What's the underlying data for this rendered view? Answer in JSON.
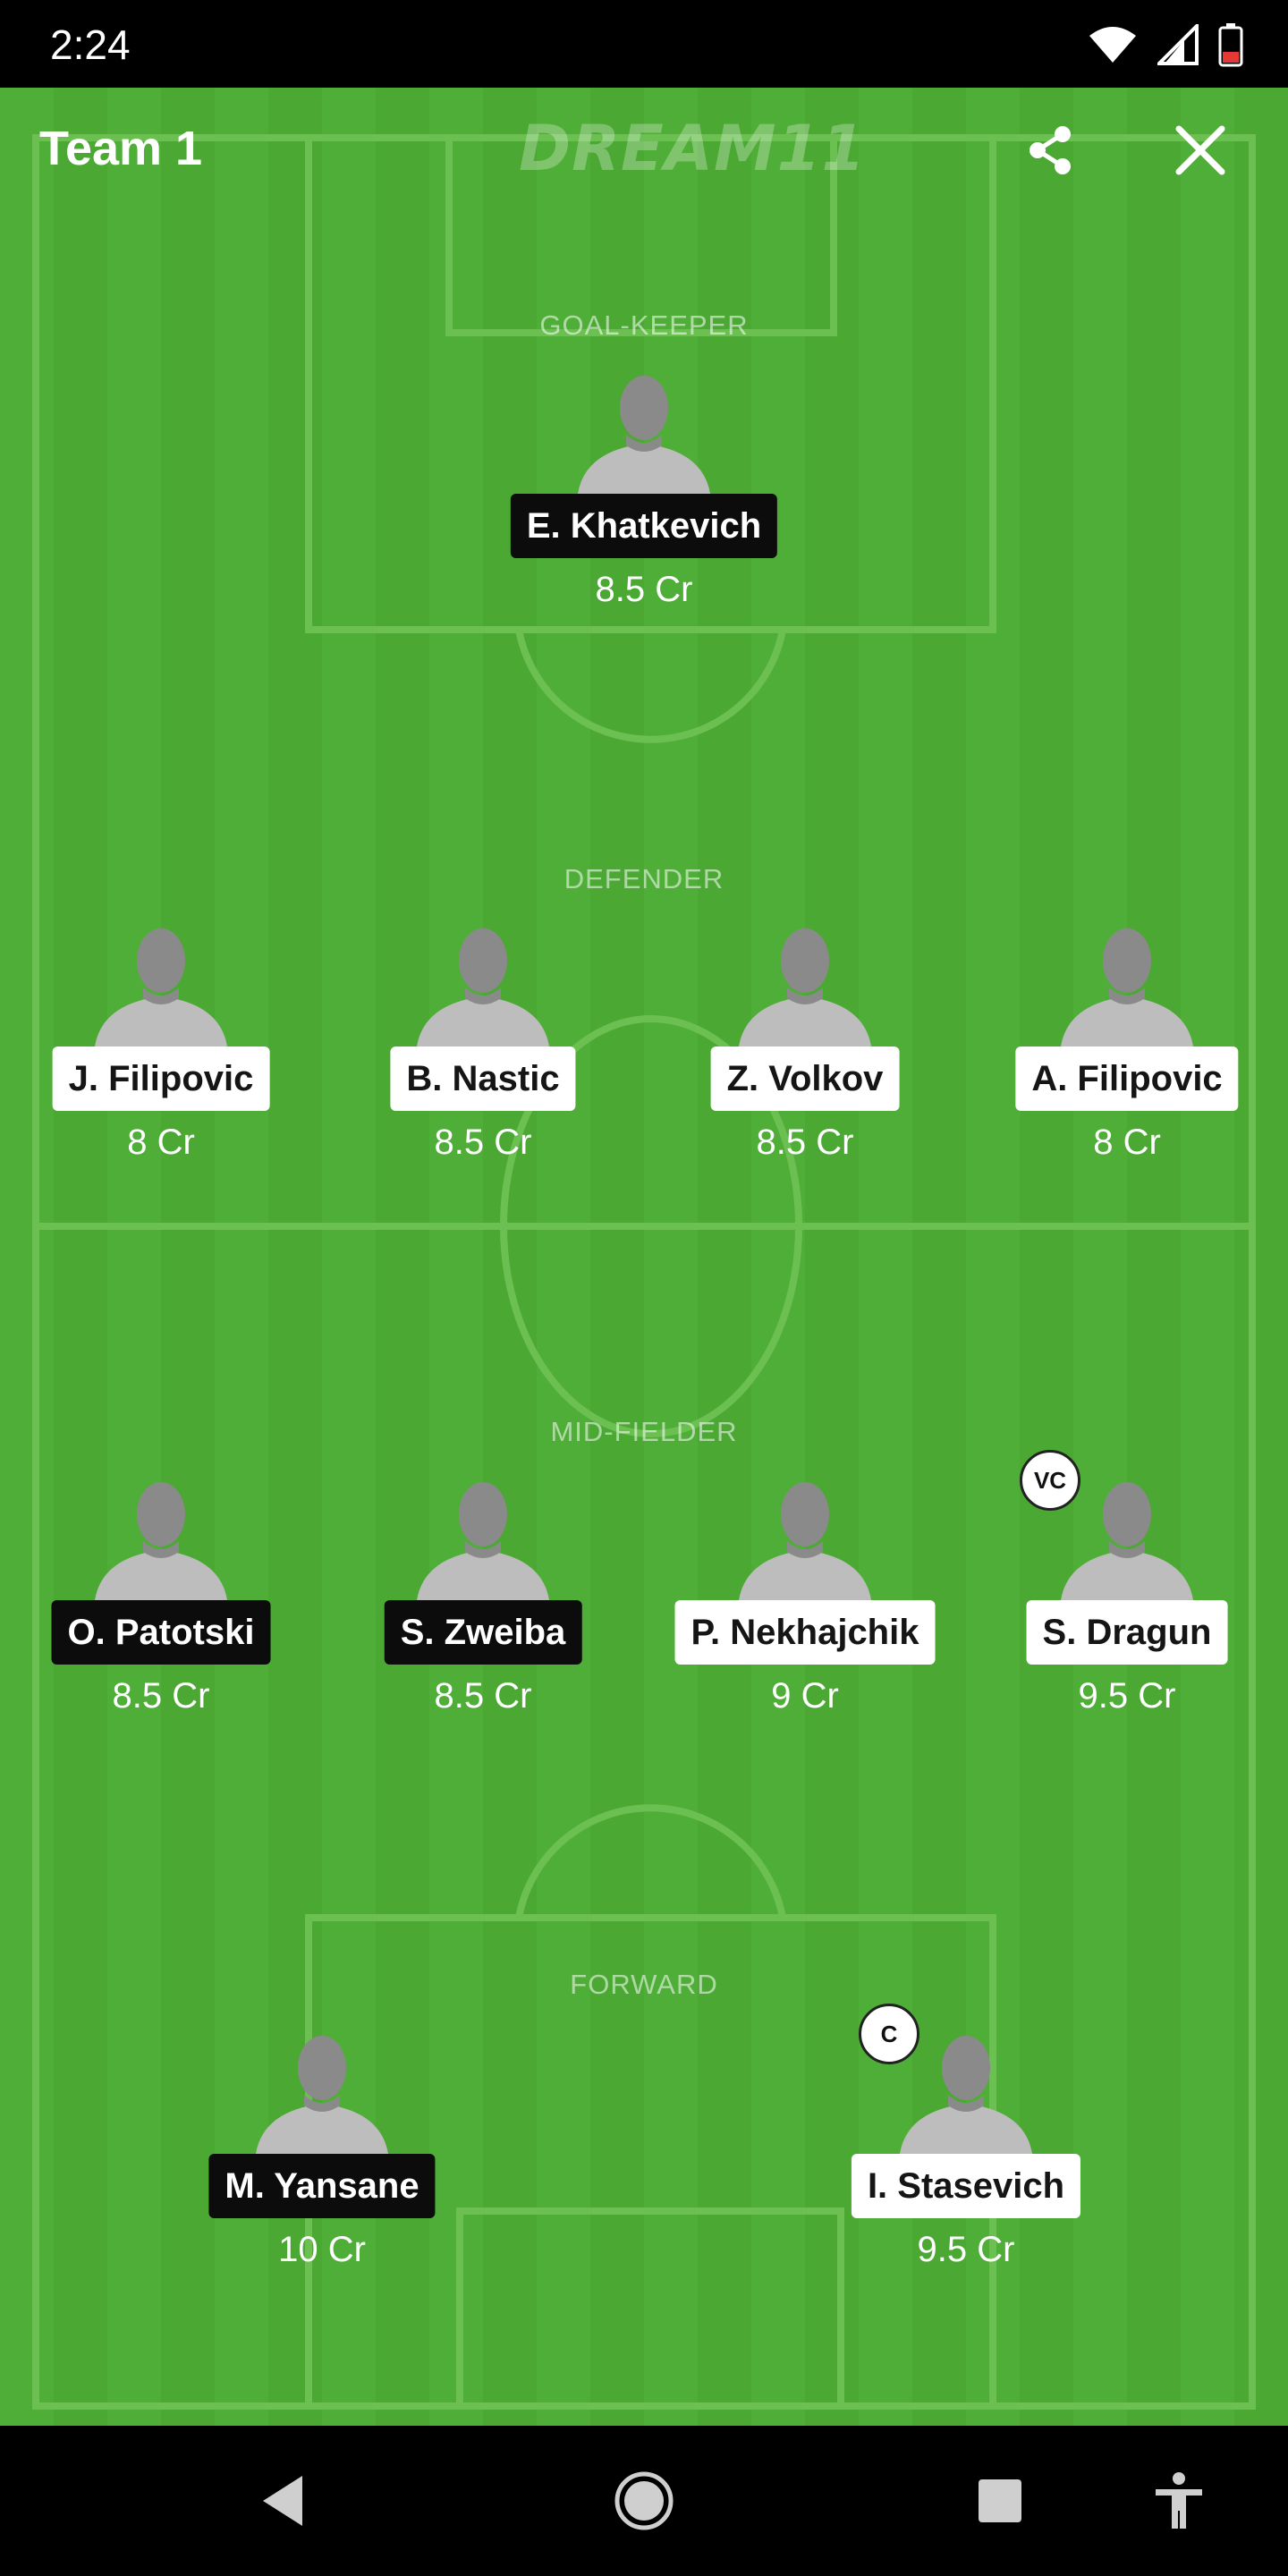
{
  "status_bar": {
    "time": "2:24"
  },
  "header": {
    "team_title": "Team 1",
    "brand": "DREAM11"
  },
  "sections": {
    "goalkeeper": "GOAL-KEEPER",
    "defender": "DEFENDER",
    "midfielder": "MID-FIELDER",
    "forward": "FORWARD"
  },
  "goalkeepers": [
    {
      "name": "E. Khatkevich",
      "credits": "8.5 Cr",
      "tag": "dark"
    }
  ],
  "defenders": [
    {
      "name": "J. Filipovic",
      "credits": "8 Cr",
      "tag": "light"
    },
    {
      "name": "B. Nastic",
      "credits": "8.5 Cr",
      "tag": "light"
    },
    {
      "name": "Z. Volkov",
      "credits": "8.5 Cr",
      "tag": "light"
    },
    {
      "name": "A. Filipovic",
      "credits": "8 Cr",
      "tag": "light"
    }
  ],
  "midfielders": [
    {
      "name": "O. Patotski",
      "credits": "8.5 Cr",
      "tag": "dark"
    },
    {
      "name": "S. Zweiba",
      "credits": "8.5 Cr",
      "tag": "dark"
    },
    {
      "name": "P. Nekhajchik",
      "credits": "9 Cr",
      "tag": "light"
    },
    {
      "name": "S. Dragun",
      "credits": "9.5 Cr",
      "tag": "light",
      "badge": "VC"
    }
  ],
  "forwards": [
    {
      "name": "M. Yansane",
      "credits": "10 Cr",
      "tag": "dark"
    },
    {
      "name": "I. Stasevich",
      "credits": "9.5 Cr",
      "tag": "light",
      "badge": "C"
    }
  ],
  "colors": {
    "pitch": "#4fae37",
    "pitch_stripe": "#4aa833",
    "line": "#6cc052",
    "avatar": "#bdbdbd",
    "avatar_head": "#8a8a8a"
  },
  "icons": {
    "share": "share-icon",
    "close": "close-icon",
    "back": "back-triangle-icon",
    "home": "home-circle-icon",
    "recents": "recents-square-icon",
    "accessibility": "accessibility-icon"
  }
}
